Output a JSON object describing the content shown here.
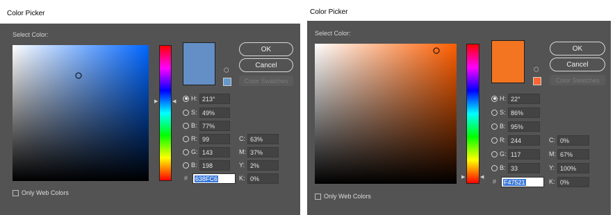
{
  "pickers": [
    {
      "title": "Color Picker",
      "select_label": "Select Color:",
      "hue_color": "#0066ff",
      "new_color": "#638FC6",
      "current_color": "#638FC6",
      "websafe_color": "#6699CC",
      "buttons": {
        "ok": "OK",
        "cancel": "Cancel",
        "swatches": "Color Swatches"
      },
      "fields": {
        "h_label": "H:",
        "h": "213°",
        "s_label": "S:",
        "s": "49%",
        "b_label": "B:",
        "b": "77%",
        "r_label": "R:",
        "r": "99",
        "g_label": "G:",
        "g": "143",
        "bl_label": "B:",
        "bl": "198",
        "c_label": "C:",
        "c": "63%",
        "m_label": "M:",
        "m": "37%",
        "y_label": "Y:",
        "y": "2%",
        "k_label": "K:",
        "k": "0%",
        "hash": "#",
        "hex": "638FC6"
      },
      "web_only_label": "Only Web Colors"
    },
    {
      "title": "Color Picker",
      "select_label": "Select Color:",
      "hue_color": "#ff5e00",
      "new_color": "#F47521",
      "current_color": "#F47521",
      "websafe_color": "#FF6633",
      "buttons": {
        "ok": "OK",
        "cancel": "Cancel",
        "swatches": "Color Swatches"
      },
      "fields": {
        "h_label": "H:",
        "h": "22°",
        "s_label": "S:",
        "s": "86%",
        "b_label": "B:",
        "b": "95%",
        "r_label": "R:",
        "r": "244",
        "g_label": "G:",
        "g": "117",
        "bl_label": "B:",
        "bl": "33",
        "c_label": "C:",
        "c": "0%",
        "m_label": "M:",
        "m": "67%",
        "y_label": "Y:",
        "y": "100%",
        "k_label": "K:",
        "k": "0%",
        "hash": "#",
        "hex": "F47521"
      },
      "web_only_label": "Only Web Colors"
    }
  ]
}
